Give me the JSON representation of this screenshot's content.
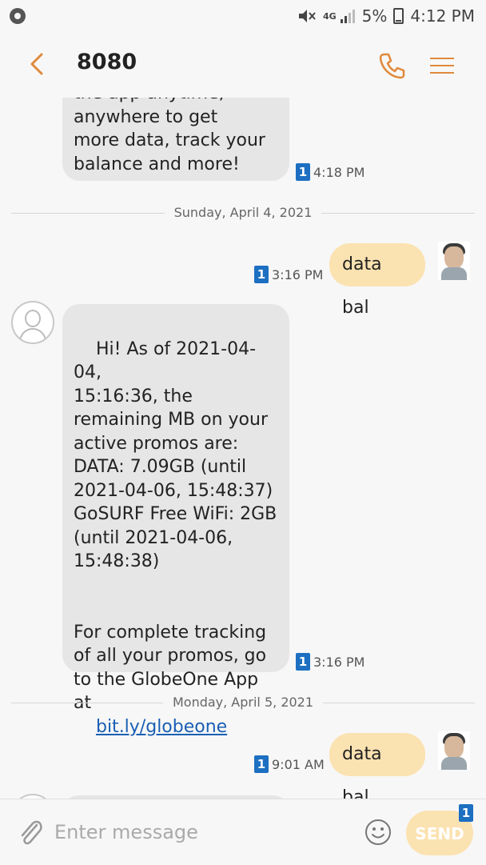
{
  "status_bar": {
    "network": "4G",
    "battery": "5%",
    "time": "4:12 PM"
  },
  "header": {
    "title": "8080"
  },
  "conversation": {
    "first_message_partial": "the app anytime,\nanywhere to get\nmore data, track your\nbalance and more!",
    "first_message_time": "4:18 PM",
    "date_divider_1": "Sunday, April 4, 2021",
    "sent_1": {
      "text": "data bal",
      "time": "3:16 PM"
    },
    "received_1": {
      "text": "Hi! As of 2021-04-04,\n15:16:36, the\nremaining MB on your\nactive promos are:\nDATA: 7.09GB (until\n2021-04-06, 15:48:37)\nGoSURF Free WiFi: 2GB\n(until 2021-04-06,\n15:48:38)\n\n\nFor complete tracking\nof all your promos, go\nto the GlobeOne App at",
      "link": "bit.ly/globeone",
      "time": "3:16 PM"
    },
    "date_divider_2": "Monday, April 5, 2021",
    "sent_2": {
      "text": "data bal",
      "time": "9:01 AM"
    },
    "sim": "1"
  },
  "composer": {
    "placeholder": "Enter message",
    "send_label": "SEND",
    "sim": "1"
  },
  "colors": {
    "accent": "#e08a3c",
    "sent_bubble": "#fbe2b1",
    "received_bubble": "#e6e6e6",
    "sim_badge": "#1d6fc1"
  }
}
